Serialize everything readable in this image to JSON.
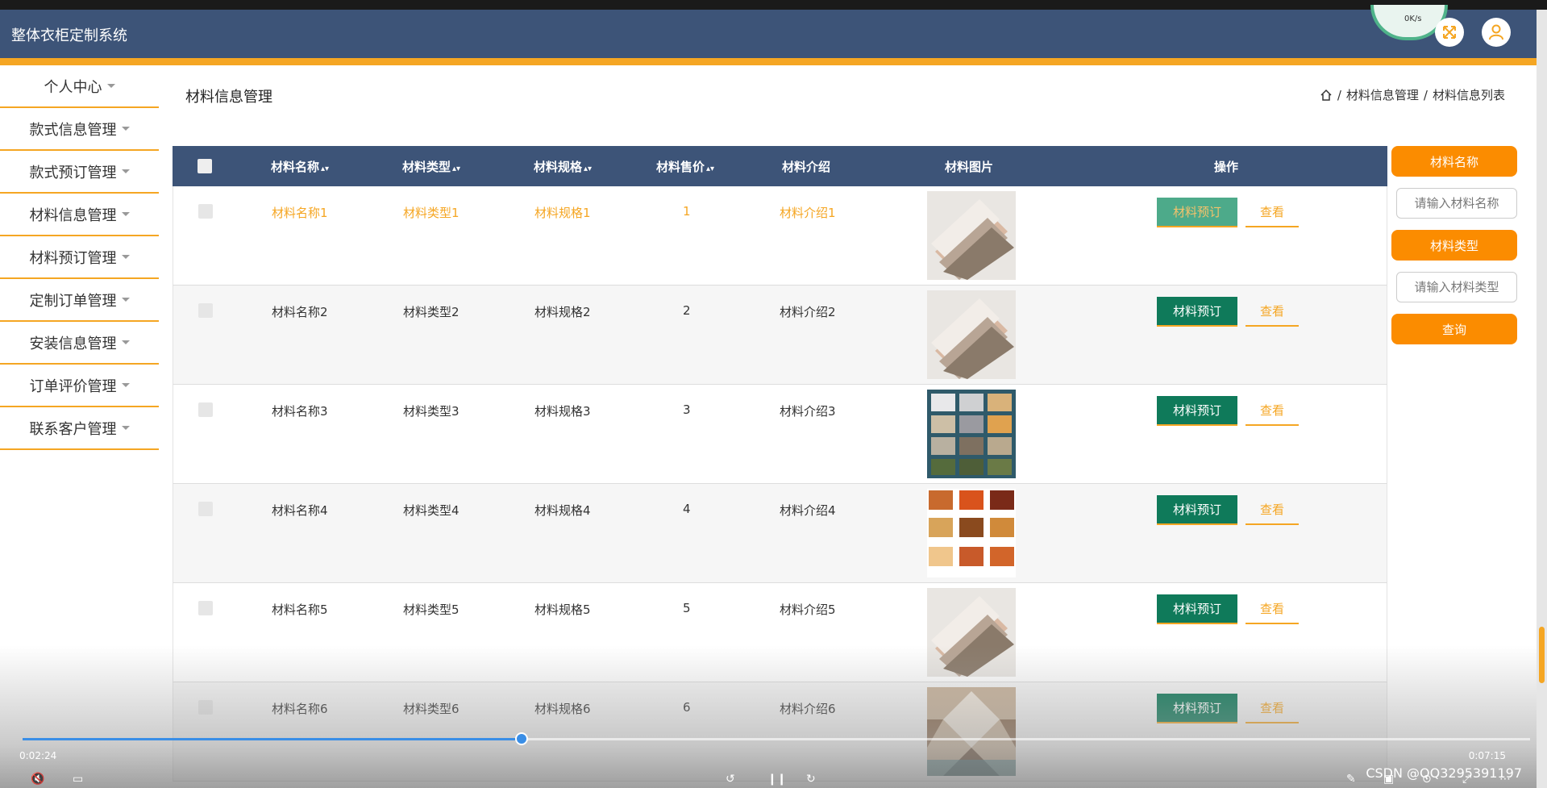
{
  "app": {
    "title": "整体衣柜定制系统",
    "net_speed": "0K/s"
  },
  "sidebar": {
    "items": [
      {
        "label": "个人中心"
      },
      {
        "label": "款式信息管理"
      },
      {
        "label": "款式预订管理"
      },
      {
        "label": "材料信息管理"
      },
      {
        "label": "材料预订管理"
      },
      {
        "label": "定制订单管理"
      },
      {
        "label": "安装信息管理"
      },
      {
        "label": "订单评价管理"
      },
      {
        "label": "联系客户管理"
      }
    ]
  },
  "page": {
    "title": "材料信息管理"
  },
  "breadcrumb": {
    "sep": "/",
    "item1": "材料信息管理",
    "item2": "材料信息列表"
  },
  "table": {
    "headers": {
      "name": "材料名称",
      "type": "材料类型",
      "spec": "材料规格",
      "price": "材料售价",
      "intro": "材料介绍",
      "image": "材料图片",
      "ops": "操作"
    },
    "rows": [
      {
        "name": "材料名称1",
        "type": "材料类型1",
        "spec": "材料规格1",
        "price": "1",
        "intro": "材料介绍1",
        "image": "wood-boards",
        "book": "材料预订",
        "view": "查看"
      },
      {
        "name": "材料名称2",
        "type": "材料类型2",
        "spec": "材料规格2",
        "price": "2",
        "intro": "材料介绍2",
        "image": "wood-boards",
        "book": "材料预订",
        "view": "查看"
      },
      {
        "name": "材料名称3",
        "type": "材料类型3",
        "spec": "材料规格3",
        "price": "3",
        "intro": "材料介绍3",
        "image": "stone-swatches",
        "book": "材料预订",
        "view": "查看"
      },
      {
        "name": "材料名称4",
        "type": "材料类型4",
        "spec": "材料规格4",
        "price": "4",
        "intro": "材料介绍4",
        "image": "wood-color-swatches",
        "book": "材料预订",
        "view": "查看"
      },
      {
        "name": "材料名称5",
        "type": "材料类型5",
        "spec": "材料规格5",
        "price": "5",
        "intro": "材料介绍5",
        "image": "wood-boards",
        "book": "材料预订",
        "view": "查看"
      },
      {
        "name": "材料名称6",
        "type": "材料类型6",
        "spec": "材料规格6",
        "price": "6",
        "intro": "材料介绍6",
        "image": "tile-pattern",
        "book": "材料预订",
        "view": "查看"
      }
    ]
  },
  "search": {
    "name_label": "材料名称",
    "name_placeholder": "请输入材料名称",
    "type_label": "材料类型",
    "type_placeholder": "请输入材料类型",
    "query_label": "查询"
  },
  "player": {
    "current": "0:02:24",
    "total": "0:07:15",
    "progress": 0.331
  },
  "watermark": "CSDN @QQ3295391197",
  "colors": {
    "header": "#3d5478",
    "accent": "#f5a623",
    "book_button": "#0f7a5a",
    "query_button": "#fb8c00"
  }
}
